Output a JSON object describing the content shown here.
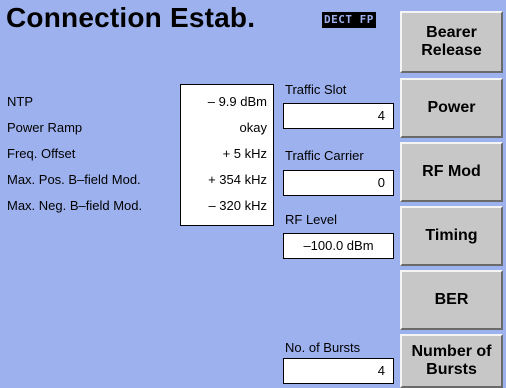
{
  "screen": {
    "title": "Connection Estab.",
    "mode_badge": "DECT FP"
  },
  "measurements": [
    {
      "label": "NTP",
      "value": "– 9.9 dBm"
    },
    {
      "label": "Power Ramp",
      "value": "okay"
    },
    {
      "label": "Freq. Offset",
      "value": "+ 5 kHz"
    },
    {
      "label": "Max. Pos. B–field Mod.",
      "value": "+ 354 kHz"
    },
    {
      "label": "Max. Neg. B–field Mod.",
      "value": "– 320 kHz"
    }
  ],
  "parameters": {
    "traffic_slot": {
      "label": "Traffic Slot",
      "value": "4"
    },
    "traffic_carrier": {
      "label": "Traffic Carrier",
      "value": "0"
    },
    "rf_level": {
      "label": "RF Level",
      "value": "–100.0 dBm"
    },
    "no_of_bursts": {
      "label": "No. of Bursts",
      "value": "4"
    }
  },
  "softkeys": {
    "bearer_release": "Bearer\nRelease",
    "power": "Power",
    "rf_mod": "RF Mod",
    "timing": "Timing",
    "ber": "BER",
    "number_of_bursts": "Number of\nBursts"
  },
  "colors": {
    "background": "#9db1ee",
    "softkey": "#c7c7c7",
    "field": "#ffffff"
  }
}
